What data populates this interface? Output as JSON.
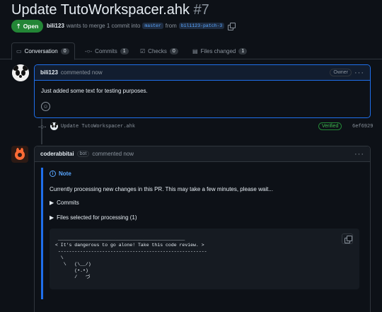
{
  "pr": {
    "title": "Update TutoWorkspacer.ahk",
    "number": "#7",
    "status": "Open",
    "author": "bili123",
    "merge_text": "wants to merge 1 commit into",
    "base_branch": "master",
    "from_text": "from",
    "head_branch": "bili123-patch-3"
  },
  "tabs": [
    {
      "label": "Conversation",
      "count": "0"
    },
    {
      "label": "Commits",
      "count": "1"
    },
    {
      "label": "Checks",
      "count": "0"
    },
    {
      "label": "Files changed",
      "count": "1"
    }
  ],
  "comment1": {
    "author": "bili123",
    "action": "commented now",
    "role": "Owner",
    "body": "Just added some text for testing purposes."
  },
  "commit": {
    "message": "Update TutoWorkspacer.ahk",
    "status": "Verified",
    "sha": "6ef6929"
  },
  "comment2": {
    "author": "coderabbitai",
    "bot_label": "bot",
    "action": "commented now",
    "note_title": "Note",
    "note_body": "Currently processing new changes in this PR. This may take a few minutes, please wait...",
    "details": [
      "Commits",
      "Files selected for processing (1)"
    ],
    "ascii_art": " ______________________________________________\n< It's dangerous to go alone! Take this code review. >\n ------------------------------------------------------\n  \\\n   \\   (\\__/)\n       (•.•)\n       /   づ"
  },
  "colors": {
    "open": "#238636",
    "link": "#58a6ff",
    "verified": "#3fb950",
    "note_border": "#1f6feb",
    "background": "#0d1117"
  },
  "icons": [
    "pr-open-icon",
    "copy-icon",
    "conversation-icon",
    "commit-icon",
    "checks-icon",
    "files-icon",
    "smiley-icon",
    "more-dots-icon",
    "info-icon"
  ]
}
